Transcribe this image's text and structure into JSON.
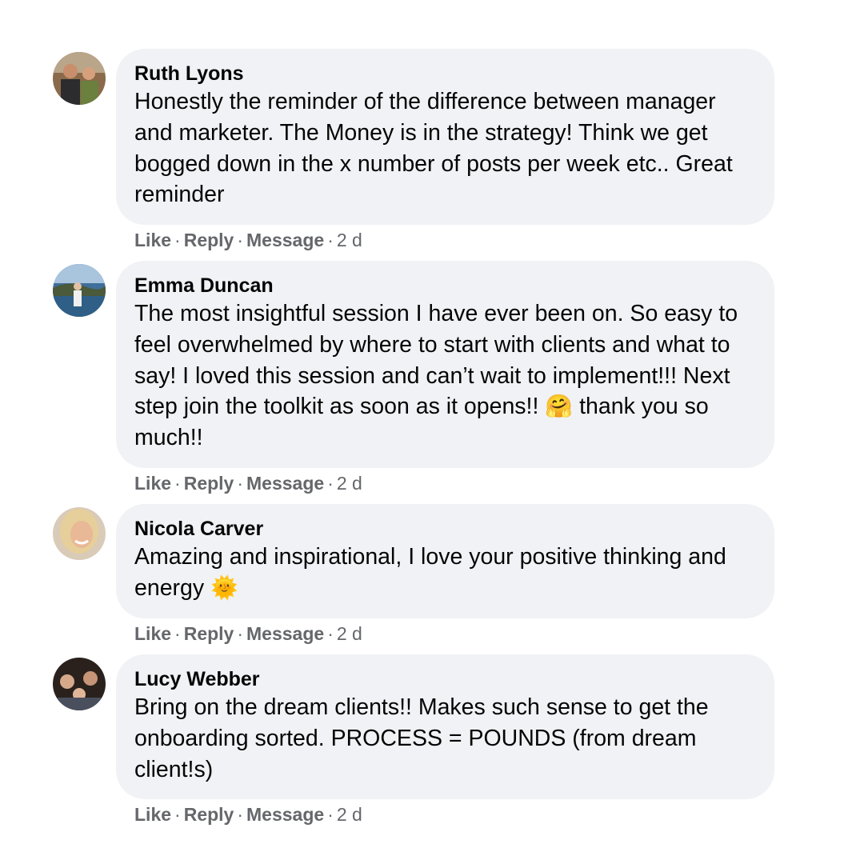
{
  "comments": [
    {
      "author": "Ruth Lyons",
      "text": "Honestly the reminder of the difference between manager and marketer. The Money is in the strategy! Think we get bogged down in the x number of posts per week etc.. Great reminder",
      "emoji": "",
      "text_after": "",
      "like": "Like",
      "reply": "Reply",
      "message": "Message",
      "time": "2 d"
    },
    {
      "author": "Emma Duncan",
      "text": "The most insightful session I have ever been on. So easy to feel overwhelmed by where to start with clients and what to say! I loved this session and can’t wait to implement!!! Next step join the toolkit as soon as it opens!! ",
      "emoji": "🤗",
      "text_after": " thank you so much!!",
      "like": "Like",
      "reply": "Reply",
      "message": "Message",
      "time": "2 d"
    },
    {
      "author": "Nicola Carver",
      "text": "Amazing and inspirational, I love your positive thinking and energy ",
      "emoji": "🌞",
      "text_after": "",
      "like": "Like",
      "reply": "Reply",
      "message": "Message",
      "time": "2 d"
    },
    {
      "author": "Lucy Webber",
      "text": "Bring on the dream clients!! Makes such sense to get the onboarding sorted. PROCESS = POUNDS (from dream client!s)",
      "emoji": "",
      "text_after": "",
      "like": "Like",
      "reply": "Reply",
      "message": "Message",
      "time": "2 d"
    }
  ]
}
